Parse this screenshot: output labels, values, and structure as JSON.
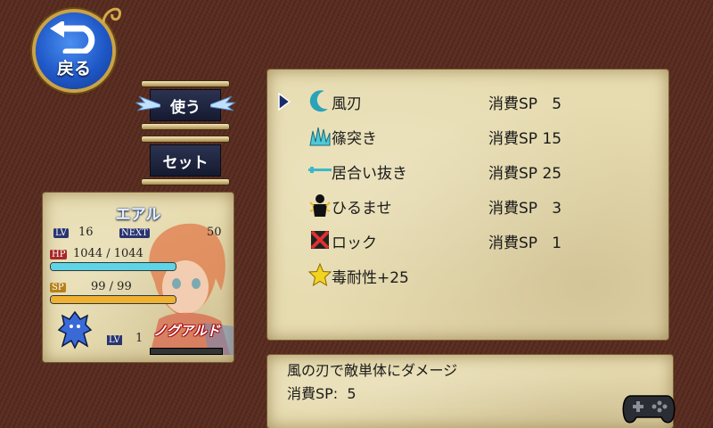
{
  "back_button": {
    "label": "戻る"
  },
  "actions": [
    {
      "label": "使う"
    },
    {
      "label": "セット"
    }
  ],
  "character": {
    "name": "エアル",
    "lv_label": "LV",
    "lv": "16",
    "next_label": "NEXT",
    "next": "50",
    "hp_label": "HP",
    "hp_text": "1044 / 1044",
    "hp_fraction": 1.0,
    "sp_label": "SP",
    "sp_text": "99 /  99",
    "sp_fraction": 1.0,
    "sub": {
      "lv_label": "LV",
      "lv": "1",
      "name": "ノグアルド"
    }
  },
  "skills": [
    {
      "icon": "crescent-moon-icon",
      "name": "風刃",
      "cost": "消費SP   5",
      "selected": true
    },
    {
      "icon": "spike-burst-icon",
      "name": "篠突き",
      "cost": "消費SP 15",
      "selected": false
    },
    {
      "icon": "slash-line-icon",
      "name": "居合い抜き",
      "cost": "消費SP 25",
      "selected": false
    },
    {
      "icon": "shadow-figure-icon",
      "name": "ひるませ",
      "cost": "消費SP   3",
      "selected": false
    },
    {
      "icon": "lock-x-icon",
      "name": "ロック",
      "cost": "消費SP   1",
      "selected": false
    },
    {
      "icon": "star-icon",
      "name": "毒耐性+25",
      "cost": "",
      "selected": false
    }
  ],
  "description": {
    "text": "風の刃で敵単体にダメージ",
    "cost": "消費SP:  5"
  },
  "colors": {
    "hp_bar": "#5fd4e6",
    "sp_bar": "#f0b030",
    "accent_blue": "#1f58c8"
  }
}
